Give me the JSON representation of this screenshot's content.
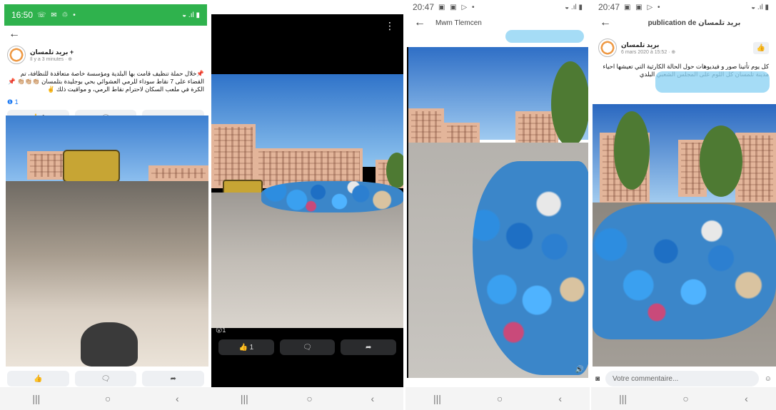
{
  "panel1": {
    "status": {
      "time": "16:50",
      "left_icons": "☏ ✉ ♲ •",
      "right_icons": "◒ .ıl ▮"
    },
    "poster": {
      "name": "بريد تلمسان +",
      "meta": "Il y a 3 minutes · ⊕"
    },
    "post_text": "📌خلال حملة تنظيف قامت بها البلدية ومؤسسة خاصة متعاقدة للنظافة، تم القضاء على 7 نقاط سوداء للرمي العشوائي بحي بوجليدة بتلمسان 👏🏼👏🏼👏🏼 📌 الكرة في ملعب السكان لاحترام نقاط الرمي، و مواقيت ذلك ✌️",
    "reactions": "❶ 1",
    "buttons": {
      "like": "👍 1",
      "comment": "🗨",
      "share": "➦"
    },
    "buttons_bottom": {
      "like": "👍",
      "comment": "🗨",
      "share": "➦"
    }
  },
  "panel2": {
    "reactions": "😮1",
    "buttons": {
      "like": "👍 1",
      "comment": "🗨",
      "share": "➦"
    },
    "menu": "⋮"
  },
  "panel3": {
    "status": {
      "time": "20:47",
      "left_icons": "▣ ▣ ▷ •",
      "right_icons": "◒ .ıl ▮"
    },
    "title": "Mwm Tlemcen",
    "volume": "🔊"
  },
  "panel4": {
    "status": {
      "time": "20:47",
      "left_icons": "▣ ▣ ▷ •",
      "right_icons": "◒ .ıl ▮"
    },
    "title": "publication de بريد تلمسان",
    "poster": {
      "name": "بريد تلمسان",
      "meta": "6 mars 2020 à 15:52 · ⊕"
    },
    "post_text": "كل يوم تأتينا صور و فيديوهات حول الحالة الكارثية التي تعيشها احياء مدينة تلمسان كل اللوم على المجلس الشعبي البلدي",
    "comment_placeholder": "Votre commentaire...",
    "like_icon": "👍"
  },
  "nav": {
    "recent": "|||",
    "home": "○",
    "back": "‹"
  },
  "colors": {
    "status_green": "#2fb24d",
    "trash_blue": "#3b86c9",
    "sky": "#4a8fd9"
  }
}
